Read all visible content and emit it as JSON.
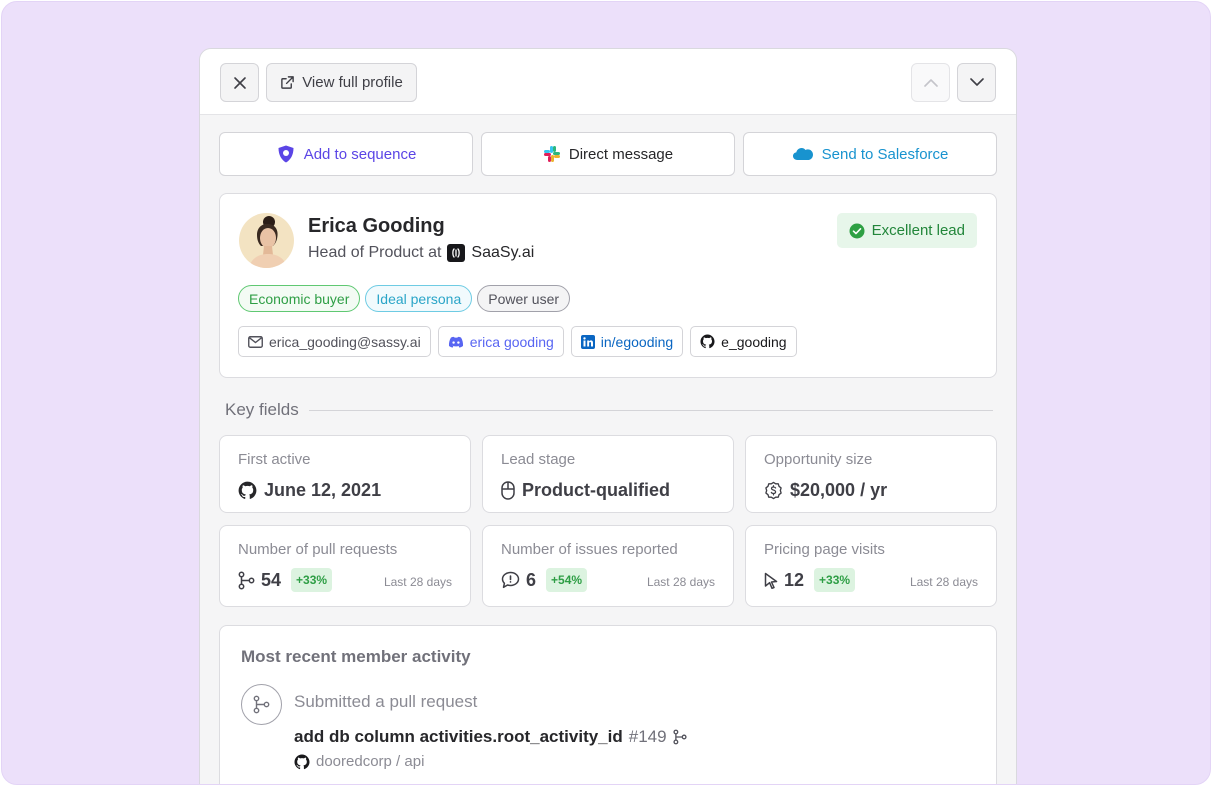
{
  "toolbar": {
    "close_icon": "close-icon",
    "view_profile_label": "View full profile",
    "prev_icon": "chevron-up-icon",
    "next_icon": "chevron-down-icon"
  },
  "actions": {
    "sequence_label": "Add to sequence",
    "message_label": "Direct message",
    "salesforce_label": "Send to Salesforce"
  },
  "profile": {
    "name": "Erica Gooding",
    "role_prefix": "Head of Product at",
    "company": "SaaSy.ai",
    "lead_status": "Excellent lead",
    "tags": [
      "Economic buyer",
      "Ideal persona",
      "Power user"
    ],
    "socials": {
      "email": "erica_gooding@sassy.ai",
      "discord": "erica gooding",
      "linkedin": "in/egooding",
      "github": "e_gooding"
    }
  },
  "key_fields": {
    "title": "Key fields",
    "first_active": {
      "label": "First active",
      "value": "June 12, 2021"
    },
    "lead_stage": {
      "label": "Lead stage",
      "value": "Product-qualified"
    },
    "opportunity": {
      "label": "Opportunity size",
      "value": "$20,000 / yr"
    },
    "pull_requests": {
      "label": "Number of pull requests",
      "value": "54",
      "delta": "+33%",
      "period": "Last 28 days"
    },
    "issues": {
      "label": "Number of issues reported",
      "value": "6",
      "delta": "+54%",
      "period": "Last 28 days"
    },
    "pricing_visits": {
      "label": "Pricing page visits",
      "value": "12",
      "delta": "+33%",
      "period": "Last 28 days"
    }
  },
  "activity": {
    "title": "Most recent member activity",
    "event": "Submitted a pull request",
    "pr_title": "add db column activities.root_activity_id",
    "pr_number": "#149",
    "repo": "dooredcorp / api"
  },
  "colors": {
    "background": "#ece0fa",
    "sequence": "#5b45e6",
    "salesforce": "#1893cf",
    "success": "#22863a"
  }
}
